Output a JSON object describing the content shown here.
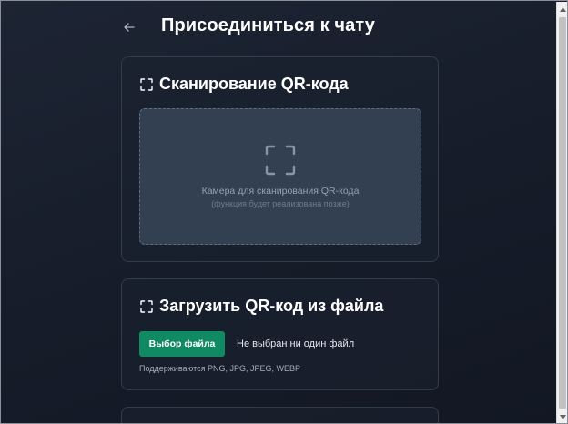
{
  "header": {
    "back_icon": "arrow-left-icon",
    "title": "Присоединиться к чату"
  },
  "scan_card": {
    "icon": "scan-frame-icon",
    "title": "Сканирование QR-кода",
    "camera_icon": "scan-frame-icon",
    "camera_text": "Камера для сканирования QR-кода",
    "camera_subtext": "(функция будет реализована позже)"
  },
  "upload_card": {
    "icon": "scan-frame-icon",
    "title": "Загрузить QR-код из файла",
    "choose_button": "Выбор файла",
    "file_status": "Не выбран ни один файл",
    "formats": "Поддерживаются PNG, JPG, JPEG, WEBP"
  },
  "colors": {
    "background": "#161c29",
    "card_border": "#323b4c",
    "scan_area": "#334052",
    "accent": "#0f8a63"
  }
}
